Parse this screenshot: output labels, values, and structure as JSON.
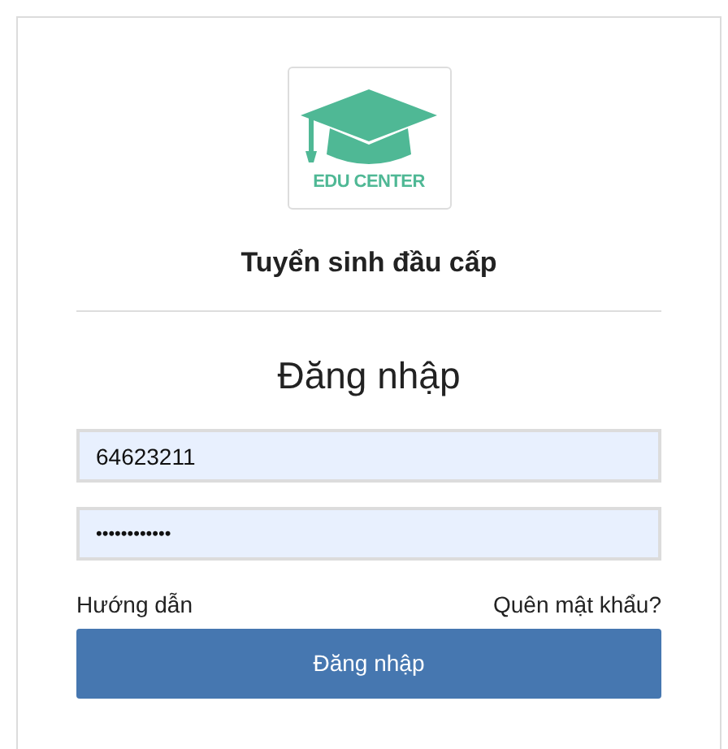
{
  "logo": {
    "text": "EDU CENTER"
  },
  "app_title": "Tuyển sinh đầu cấp",
  "heading": "Đăng nhập",
  "username": {
    "value": "64623211"
  },
  "password": {
    "value": "••••••••••••"
  },
  "links": [
    "Hướng dẫn",
    "Quên mật khẩu?"
  ],
  "submit_button": "Đăng nhập"
}
